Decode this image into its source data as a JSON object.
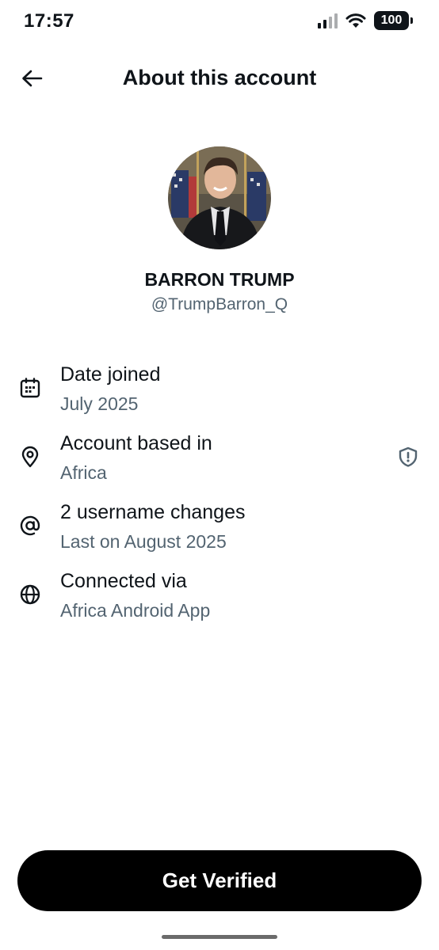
{
  "status_bar": {
    "time": "17:57",
    "battery": "100",
    "signal_icon": "cellular-signal-icon",
    "wifi_icon": "wifi-icon",
    "battery_icon": "battery-icon"
  },
  "header": {
    "back_icon": "arrow-left-icon",
    "title": "About this account"
  },
  "profile": {
    "name": "BARRON TRUMP",
    "handle": "@TrumpBarron_Q",
    "avatar_icon": "profile-photo"
  },
  "info": [
    {
      "icon": "calendar-icon",
      "label": "Date joined",
      "value": "July 2025"
    },
    {
      "icon": "location-pin-icon",
      "label": "Account based in",
      "value": "Africa",
      "aside_icon": "shield-alert-icon"
    },
    {
      "icon": "at-sign-icon",
      "label": "2 username changes",
      "value": "Last on August 2025"
    },
    {
      "icon": "globe-icon",
      "label": "Connected via",
      "value": "Africa Android App"
    }
  ],
  "cta": {
    "label": "Get Verified"
  },
  "colors": {
    "primary_text": "#0f1419",
    "secondary_text": "#536471",
    "cta_background": "#000000",
    "background": "#ffffff"
  }
}
